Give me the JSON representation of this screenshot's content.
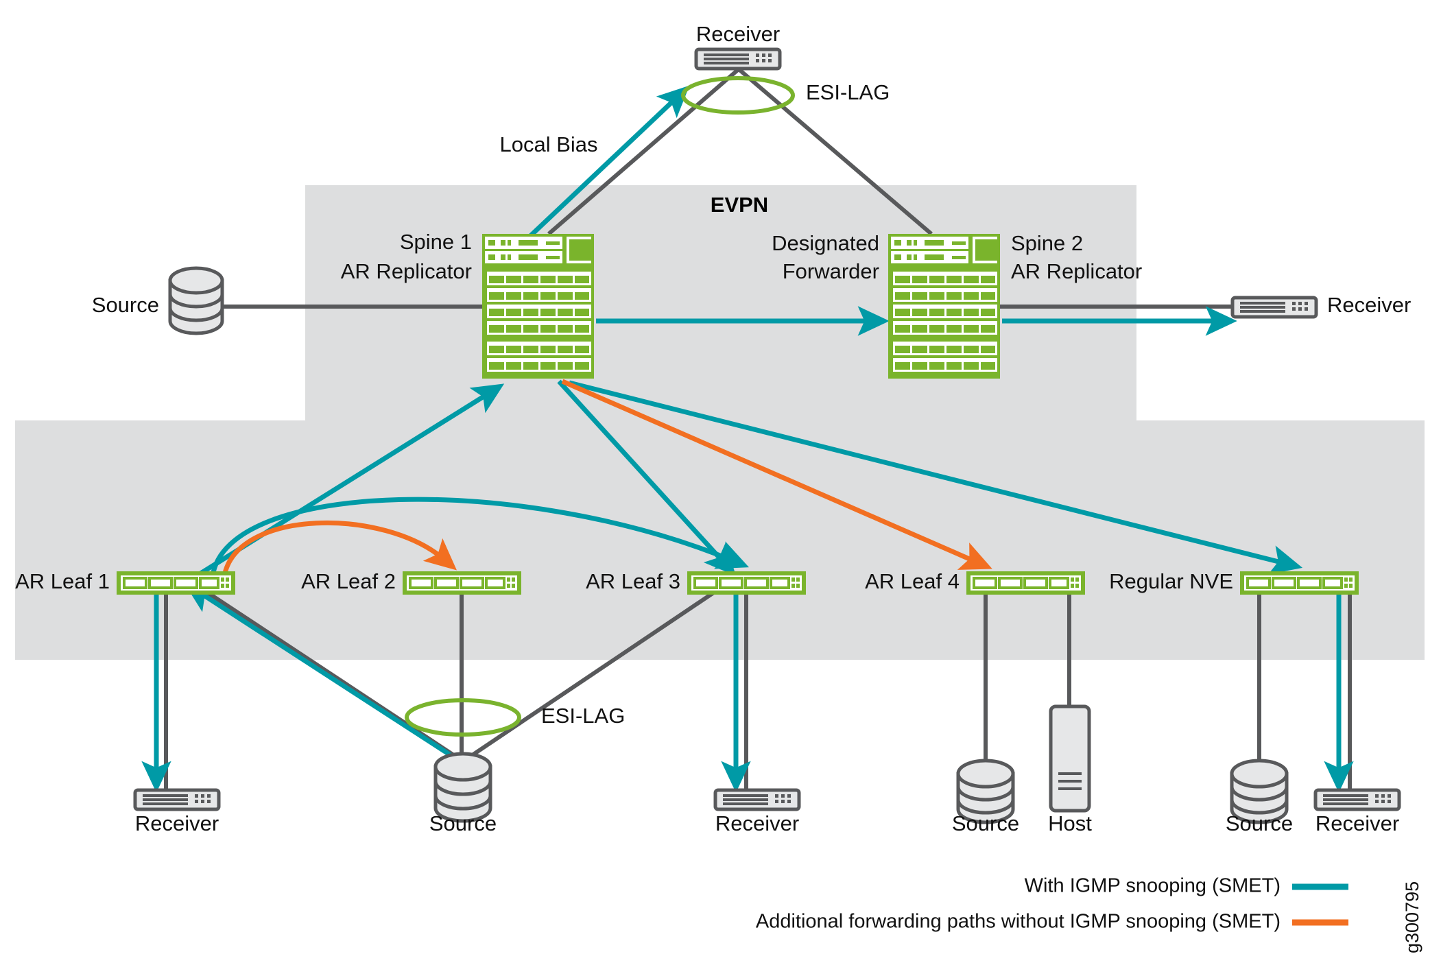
{
  "figure": {
    "id_label": "g300795",
    "zones": [
      {
        "name": "EVPN",
        "label": "EVPN"
      },
      {
        "name": "fabric-underlay",
        "label": ""
      }
    ]
  },
  "nodes": {
    "top_receiver": {
      "label": "Receiver",
      "icon": "switch-icon"
    },
    "esi_lag_top": {
      "label": "ESI-LAG",
      "icon": "ellipse-ring-icon"
    },
    "local_bias": {
      "label": "Local Bias"
    },
    "spine1": {
      "label_line1": "Spine 1",
      "label_line2": "AR Replicator",
      "icon": "chassis-icon"
    },
    "spine2": {
      "label_line1": "Spine 2",
      "label_line2": "AR Replicator",
      "icon": "chassis-icon"
    },
    "designated_forwarder": {
      "label_line1": "Designated",
      "label_line2": "Forwarder"
    },
    "left_source": {
      "label": "Source",
      "icon": "database-cylinder-icon"
    },
    "right_receiver": {
      "label": "Receiver",
      "icon": "switch-icon"
    },
    "leaf1": {
      "label": "AR Leaf 1",
      "icon": "switch-icon"
    },
    "leaf2": {
      "label": "AR Leaf 2",
      "icon": "switch-icon"
    },
    "leaf3": {
      "label": "AR Leaf 3",
      "icon": "switch-icon"
    },
    "leaf4": {
      "label": "AR Leaf 4",
      "icon": "switch-icon"
    },
    "regular_nve": {
      "label": "Regular NVE",
      "icon": "switch-icon"
    },
    "esi_lag_bottom": {
      "label": "ESI-LAG",
      "icon": "ellipse-ring-icon"
    },
    "leaf1_receiver": {
      "label": "Receiver",
      "icon": "switch-icon"
    },
    "esi_source": {
      "label": "Source",
      "icon": "database-cylinder-icon"
    },
    "leaf3_receiver": {
      "label": "Receiver",
      "icon": "switch-icon"
    },
    "leaf4_source": {
      "label": "Source",
      "icon": "database-cylinder-icon"
    },
    "leaf4_host": {
      "label": "Host",
      "icon": "host-tower-icon"
    },
    "nve_source": {
      "label": "Source",
      "icon": "database-cylinder-icon"
    },
    "nve_receiver": {
      "label": "Receiver",
      "icon": "switch-icon"
    }
  },
  "legend": {
    "items": [
      {
        "label": "With IGMP snooping (SMET)",
        "color": "#009aa6",
        "swatch": "line-swatch"
      },
      {
        "label": "Additional forwarding paths without IGMP snooping (SMET)",
        "color": "#f26f21",
        "swatch": "line-swatch"
      }
    ]
  },
  "colors": {
    "band_gray": "#dddedf",
    "device_green": "#7ab42c",
    "link_gray": "#58595b",
    "teal": "#009aa6",
    "orange": "#f26f21",
    "ring_green": "#7ab32e"
  }
}
